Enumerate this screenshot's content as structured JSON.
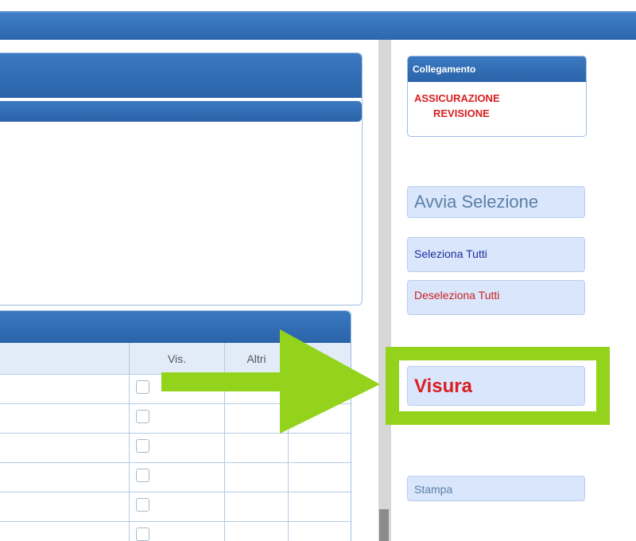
{
  "collegamento": {
    "title": "Collegamento",
    "items": [
      "ASSICURAZIONE",
      "REVISIONE"
    ]
  },
  "buttons": {
    "avvia_selezione": "Avvia Selezione",
    "seleziona_tutti": "Seleziona Tutti",
    "deseleziona_tutti": "Deseleziona Tutti",
    "visura": "Visura",
    "stampa": "Stampa"
  },
  "grid": {
    "columns": [
      "Vis.",
      "Altri"
    ],
    "row_count": 6
  },
  "colors": {
    "header_blue": "#2e6bb0",
    "button_bg": "#d9e6fb",
    "link_red": "#d91f1f",
    "highlight_green": "#93d31b"
  }
}
